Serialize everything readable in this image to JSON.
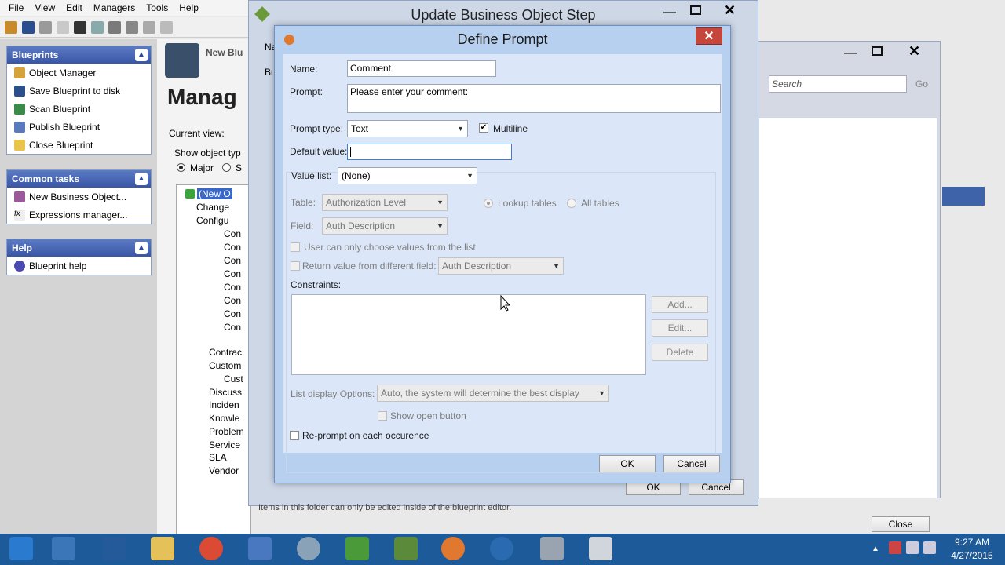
{
  "menubar": [
    "File",
    "View",
    "Edit",
    "Managers",
    "Tools",
    "Help"
  ],
  "left_panel": {
    "blueprints": {
      "title": "Blueprints",
      "items": [
        "Object Manager",
        "Save Blueprint to disk",
        "Scan Blueprint",
        "Publish Blueprint",
        "Close Blueprint"
      ]
    },
    "common_tasks": {
      "title": "Common tasks",
      "items": [
        "New Business Object...",
        "Expressions manager..."
      ]
    },
    "help": {
      "title": "Help",
      "items": [
        "Blueprint help"
      ]
    }
  },
  "main": {
    "header_small": "New Blu",
    "header_big": "Manag",
    "current_view": "Current view:",
    "show_object_type": "Show object typ",
    "radio_major": "Major",
    "radio_s": "S",
    "tree": [
      "(New O",
      "Change",
      "Configu",
      "Con",
      "Con",
      "Con",
      "Con",
      "Con",
      "Con",
      "Con",
      "Con",
      "Contrac",
      "Custom",
      "Cust",
      "Discuss",
      "Inciden",
      "Knowle",
      "Problem",
      "Service",
      "SLA",
      "Vendor"
    ],
    "footer_text": "Items in this folder can only be edited inside of the blueprint editor."
  },
  "update_window": {
    "title": "Update Business Object Step",
    "ok": "OK",
    "cancel": "Cancel",
    "na": "Na",
    "bu": "Bu"
  },
  "right_window": {
    "search_placeholder": "Search",
    "go": "Go",
    "close": "Close"
  },
  "dialog": {
    "title": "Define Prompt",
    "name_label": "Name:",
    "name_value": "Comment",
    "prompt_label": "Prompt:",
    "prompt_value": "Please enter your comment:",
    "prompt_type_label": "Prompt type:",
    "prompt_type_value": "Text",
    "multiline_label": "Multiline",
    "default_value_label": "Default value:",
    "default_value": "",
    "value_list_label": "Value list:",
    "value_list_value": "(None)",
    "table_label": "Table:",
    "table_value": "Authorization Level",
    "lookup_tables": "Lookup tables",
    "all_tables": "All tables",
    "field_label": "Field:",
    "field_value": "Auth Description",
    "user_choose_label": "User can only choose values from the list",
    "return_value_label": "Return value from different field:",
    "return_field_value": "Auth Description",
    "constraints_label": "Constraints:",
    "add_button": "Add...",
    "edit_button": "Edit...",
    "delete_button": "Delete",
    "list_display_label": "List display Options:",
    "list_display_value": "Auto, the system will determine the best display",
    "show_open_button": "Show open button",
    "reprompt_label": "Re-prompt on each occurence",
    "ok": "OK",
    "cancel": "Cancel"
  },
  "taskbar": {
    "time": "9:27 AM",
    "date": "4/27/2015"
  }
}
